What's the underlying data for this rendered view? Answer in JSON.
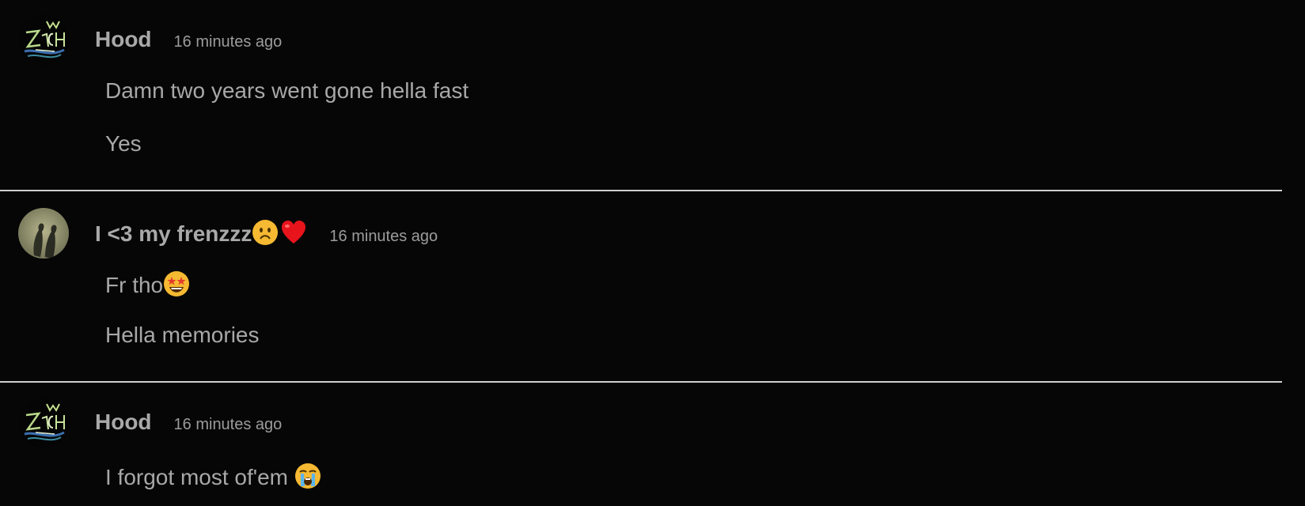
{
  "colors": {
    "background": "#060606",
    "divider": "#cfcfcf",
    "text": "#a8a8a8"
  },
  "messages": [
    {
      "author": "Hood",
      "avatar_icon": "zach-logo-avatar",
      "time": "16 minutes ago",
      "lines": [
        "Damn two years went gone hella fast",
        "Yes"
      ]
    },
    {
      "author": "I <3 my frenzzz",
      "author_emojis": [
        "frowning-face-icon",
        "red-heart-icon"
      ],
      "avatar_icon": "shadow-photo-avatar",
      "time": "16 minutes ago",
      "lines": [
        "Fr tho",
        "Hella memories"
      ],
      "line_emojis": [
        "star-struck-face-icon"
      ]
    },
    {
      "author": "Hood",
      "avatar_icon": "zach-logo-avatar",
      "time": "16 minutes ago",
      "lines": [
        "I forgot most of'em"
      ],
      "line_emojis": [
        "loudly-crying-face-icon"
      ]
    }
  ]
}
